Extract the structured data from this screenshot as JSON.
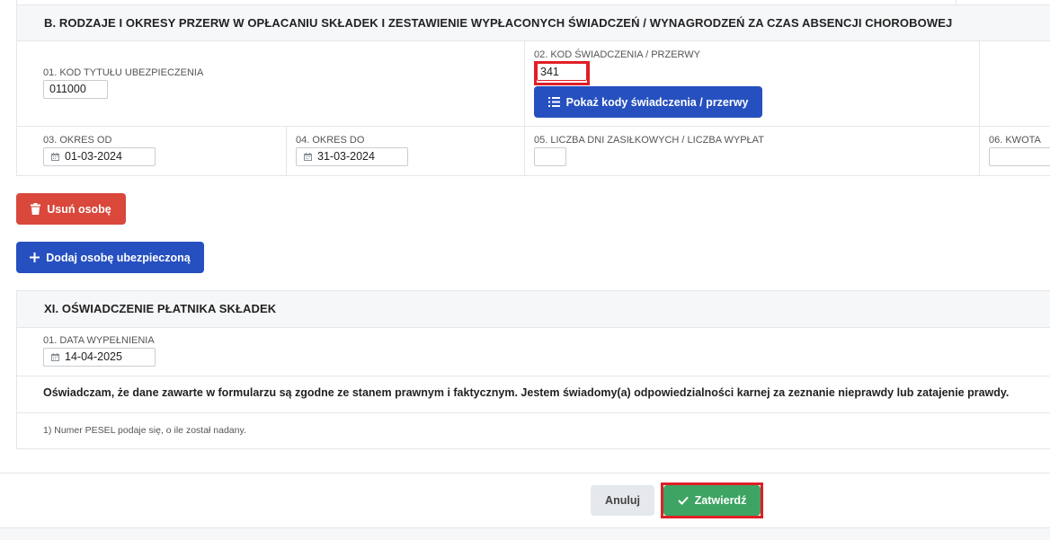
{
  "sectionB": {
    "title": "B. RODZAJE I OKRESY PRZERW W OPŁACANIU SKŁADEK I ZESTAWIENIE WYPŁACONYCH ŚWIADCZEŃ / WYNAGRODZEŃ ZA CZAS ABSENCJI CHOROBOWEJ",
    "field01_label": "01. KOD TYTUŁU UBEZPIECZENIA",
    "field01_value": "011000",
    "field02_label": "02. KOD ŚWIADCZENIA / PRZERWY",
    "field02_value": "341",
    "show_codes_button": "Pokaż kody świadczenia / przerwy",
    "field03_label": "03. OKRES OD",
    "field03_value": "01-03-2024",
    "field04_label": "04. OKRES DO",
    "field04_value": "31-03-2024",
    "field05_label": "05. LICZBA DNI ZASIŁKOWYCH / LICZBA WYPŁAT",
    "field05_value": "",
    "field06_label": "06. KWOTA",
    "field06_value": ""
  },
  "actions": {
    "remove_person": "Usuń osobę",
    "add_person": "Dodaj osobę ubezpieczoną"
  },
  "sectionXI": {
    "title": "XI. OŚWIADCZENIE PŁATNIKA SKŁADEK",
    "date_label": "01. DATA WYPEŁNIENIA",
    "date_value": "14-04-2025",
    "declaration": "Oświadczam, że dane zawarte w formularzu są zgodne ze stanem prawnym i faktycznym. Jestem świadomy(a) odpowiedzialności karnej za zeznanie nieprawdy lub zatajenie prawdy.",
    "footnote": "1) Numer PESEL podaje się, o ile został nadany."
  },
  "footer": {
    "cancel": "Anuluj",
    "confirm": "Zatwierdź"
  },
  "colors": {
    "primary": "#2650c0",
    "danger": "#d9483b",
    "success": "#3ea463",
    "highlight": "#e01f26"
  },
  "icons": {
    "calendar": "calendar-icon",
    "list": "list-icon",
    "trash": "trash-icon",
    "plus": "plus-icon",
    "check": "check-icon"
  }
}
